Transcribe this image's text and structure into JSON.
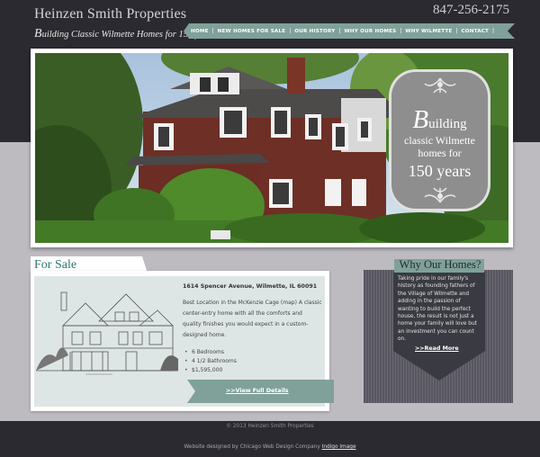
{
  "header": {
    "title": "Heinzen Smith Properties",
    "tagline_first": "B",
    "tagline_rest": "uilding Classic Wilmette Homes for 150 years",
    "phone": "847-256-2175"
  },
  "nav": {
    "items": [
      "HOME",
      "NEW HOMES FOR SALE",
      "OUR HISTORY",
      "WHY OUR HOMES",
      "WHY WILMETTE",
      "CONTACT"
    ],
    "separator": "|"
  },
  "hero": {
    "badge_first": "B",
    "badge_line1_rest": "uilding",
    "badge_line2": "classic Wilmette",
    "badge_line3": "homes for",
    "badge_line4": "150 years",
    "photo_icon": "house-photo"
  },
  "for_sale": {
    "heading": "For Sale",
    "address": "1614 Spencer Avenue, Wilmette, IL 60091",
    "description": "Best Location in the McKenzie Cage (map) A classic center-entry home with all the comforts and quality finishes you would expect in a custom-designed home.",
    "features": [
      "6 Bedrooms",
      "4 1/2 Bathrooms",
      "$1,595,000"
    ],
    "link_label": ">>View Full Details",
    "drawing_icon": "house-sketch"
  },
  "why": {
    "heading": "Why Our Homes?",
    "text": "Taking pride in our family's history as founding fathers of the Village of Wilmette and adding in the passion of wanting to build the perfect house, the result is not just a home your family will love but an investment you can count on.",
    "link_label": ">>Read More"
  },
  "footer": {
    "copyright": "© 2013 Heinzen Smith Properties",
    "credit_text": "Website designed by Chicago Web Design Company",
    "credit_link": "Indigo Image"
  },
  "colors": {
    "dark": "#2b2a30",
    "accent_teal": "#80a09a",
    "heading_teal": "#2d7770",
    "page_gray": "#bdbbc0"
  }
}
